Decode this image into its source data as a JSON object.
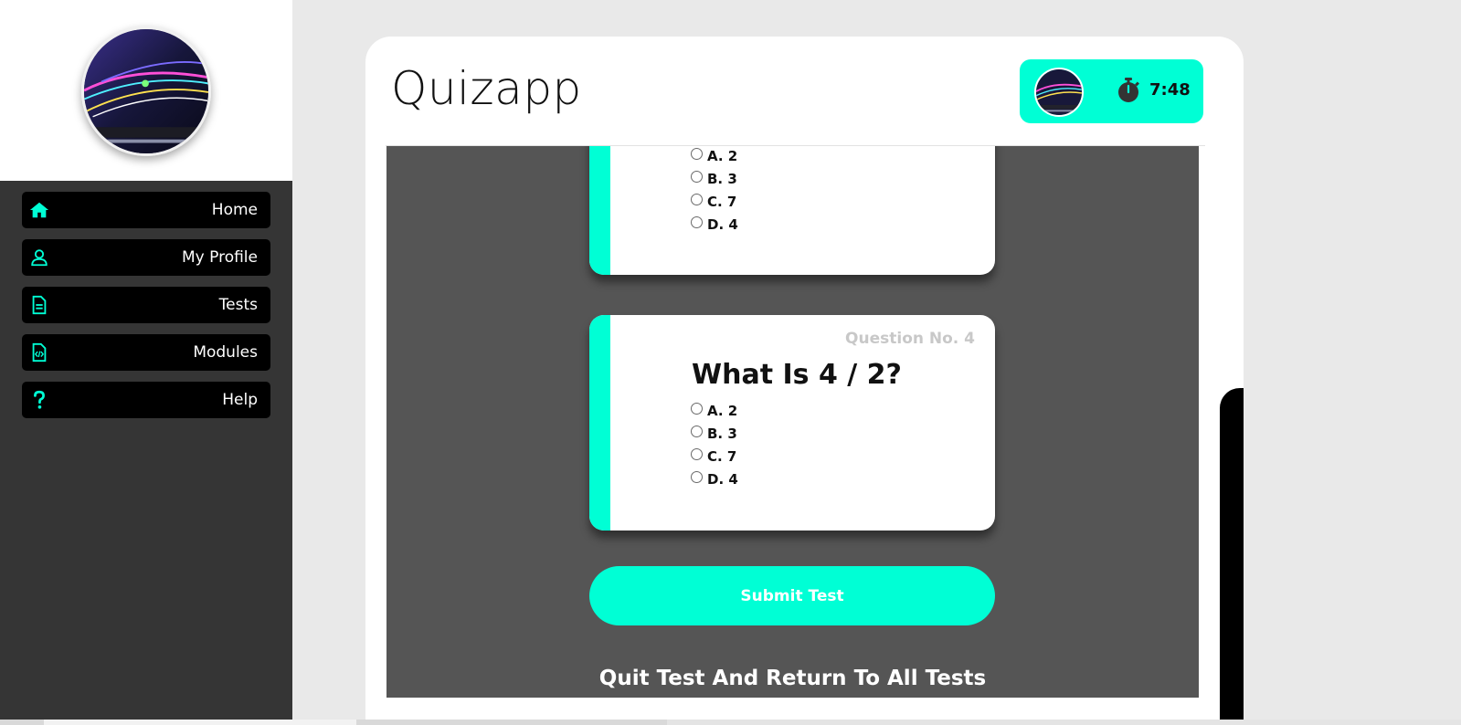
{
  "sidebar": {
    "profile_image": "laptop-wallpaper-avatar",
    "items": [
      {
        "label": "Home",
        "icon": "home-icon"
      },
      {
        "label": "My Profile",
        "icon": "user-icon"
      },
      {
        "label": "Tests",
        "icon": "document-icon"
      },
      {
        "label": "Modules",
        "icon": "code-file-icon"
      },
      {
        "label": "Help",
        "icon": "question-icon"
      }
    ]
  },
  "header": {
    "title": "Quizapp",
    "timer": "7:48"
  },
  "questions": [
    {
      "options": [
        "A. 2",
        "B. 3",
        "C. 7",
        "D. 4"
      ]
    },
    {
      "number_label": "Question No. 4",
      "text": "What Is 4 / 2?",
      "options": [
        "A. 2",
        "B. 3",
        "C. 7",
        "D. 4"
      ]
    }
  ],
  "actions": {
    "submit": "Submit Test",
    "quit": "Quit Test And Return To All Tests"
  },
  "colors": {
    "accent": "#00ffd5",
    "sidebar_dark": "#353535",
    "content_dark": "#555555"
  }
}
